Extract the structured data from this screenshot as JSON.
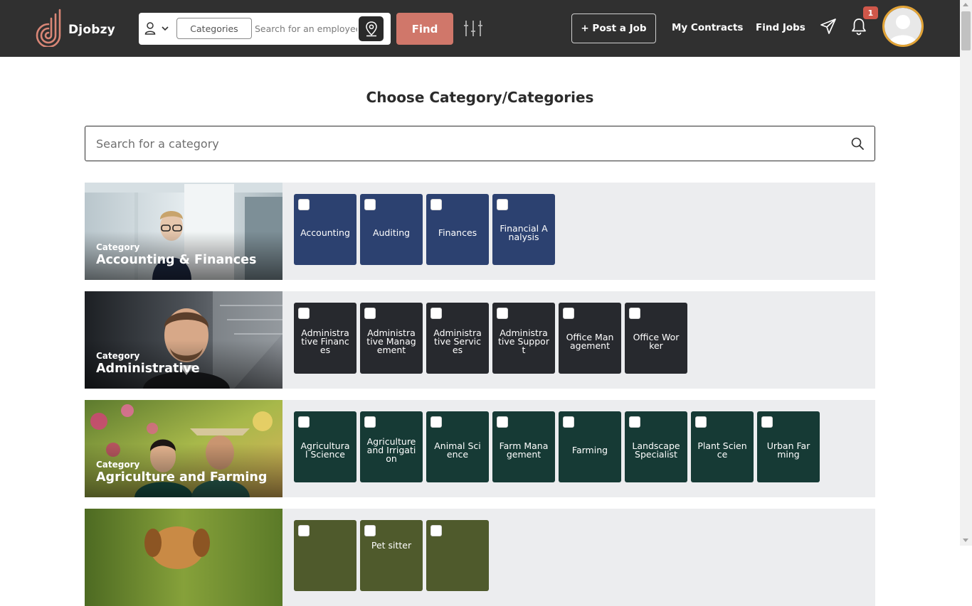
{
  "header": {
    "brand": "Djobzy",
    "search": {
      "categories_label": "Categories",
      "employee_placeholder": "Search for an employee"
    },
    "find_label": "Find",
    "post_job_label": "+ Post a Job",
    "nav": {
      "my_contracts": "My Contracts",
      "find_jobs": "Find Jobs"
    },
    "notification_count": "1"
  },
  "page": {
    "title": "Choose Category/Categories",
    "search_placeholder": "Search for a category"
  },
  "categories": [
    {
      "label": "Category",
      "name": "Accounting & Finances",
      "tile_color": "#2c4170",
      "items": [
        "Accounting",
        "Auditing",
        "Finances",
        "Financial Analysis"
      ]
    },
    {
      "label": "Category",
      "name": "Administrative",
      "tile_color": "#27292e",
      "items": [
        "Administrative Finances",
        "Administrative Management",
        "Administrative Services",
        "Administrative Support",
        "Office Management",
        "Office Worker"
      ]
    },
    {
      "label": "Category",
      "name": "Agriculture and Farming",
      "tile_color": "#163a35",
      "items": [
        "Agricultural Science",
        "Agriculture and Irrigation",
        "Animal Science",
        "Farm Management",
        "Farming",
        "Landscape Specialist",
        "Plant Science",
        "Urban Farming"
      ]
    },
    {
      "label": "",
      "name": "",
      "tile_color": "#4f5a2c",
      "items": [
        "",
        "Pet sitter",
        ""
      ]
    }
  ],
  "colors": {
    "header_bg": "#303030",
    "find_button": "#d0776a",
    "badge": "#d0574a",
    "avatar_ring": "#e3a436",
    "row_bg": "#ecedef"
  },
  "icons": [
    "logo-icon",
    "user-icon",
    "chevron-down-icon",
    "location-pin-icon",
    "filter-sliders-icon",
    "send-icon",
    "bell-icon",
    "avatar-icon",
    "search-icon"
  ]
}
